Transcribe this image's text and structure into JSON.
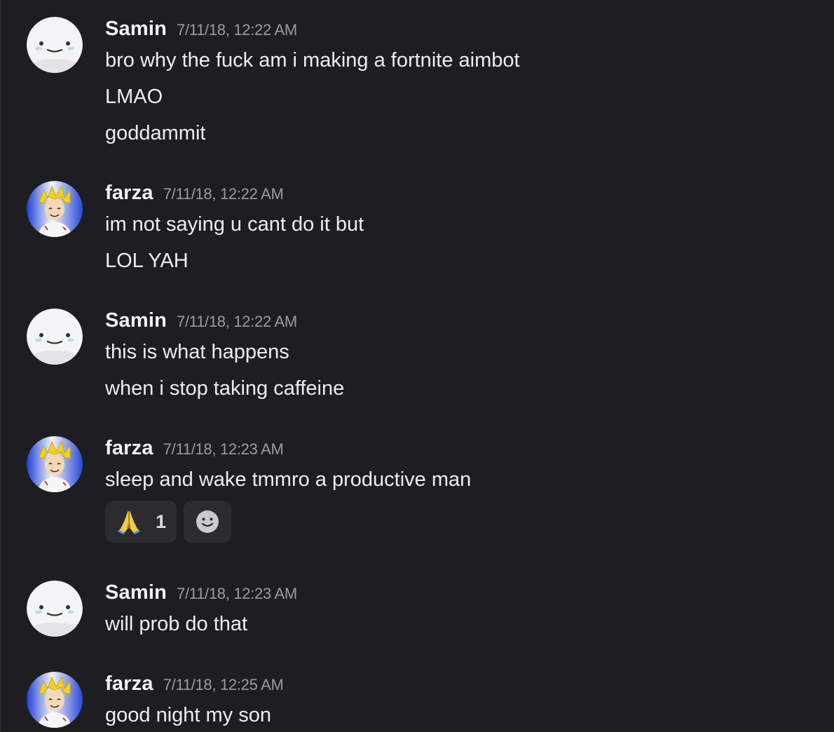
{
  "messages": [
    {
      "author": "Samin",
      "timestamp": "7/11/18, 12:22 AM",
      "avatar": "blank-face-avatar",
      "lines": [
        "bro why the fuck am i making a fortnite aimbot",
        "LMAO",
        "goddammit"
      ]
    },
    {
      "author": "farza",
      "timestamp": "7/11/18, 12:22 AM",
      "avatar": "anime-character-avatar",
      "lines": [
        "im not saying u cant do it but",
        "LOL YAH"
      ]
    },
    {
      "author": "Samin",
      "timestamp": "7/11/18, 12:22 AM",
      "avatar": "blank-face-avatar",
      "lines": [
        "this is what happens",
        "when i stop taking caffeine"
      ]
    },
    {
      "author": "farza",
      "timestamp": "7/11/18, 12:23 AM",
      "avatar": "anime-character-avatar",
      "lines": [
        "sleep and wake tmmro a productive man"
      ],
      "reactions": [
        {
          "emoji": "🙏",
          "icon": "folded-hands-icon",
          "count": "1"
        },
        {
          "icon": "add-reaction-smiley-icon"
        }
      ]
    },
    {
      "author": "Samin",
      "timestamp": "7/11/18, 12:23 AM",
      "avatar": "blank-face-avatar",
      "lines": [
        "will prob do that"
      ]
    },
    {
      "author": "farza",
      "timestamp": "7/11/18, 12:25 AM",
      "avatar": "anime-character-avatar",
      "lines": [
        "good night my son"
      ]
    }
  ],
  "colors": {
    "background": "#1e1e22",
    "author": "#f2f3f5",
    "timestamp": "#9a9ca2",
    "text": "#eceef0",
    "reaction_bg": "#2b2b30"
  }
}
